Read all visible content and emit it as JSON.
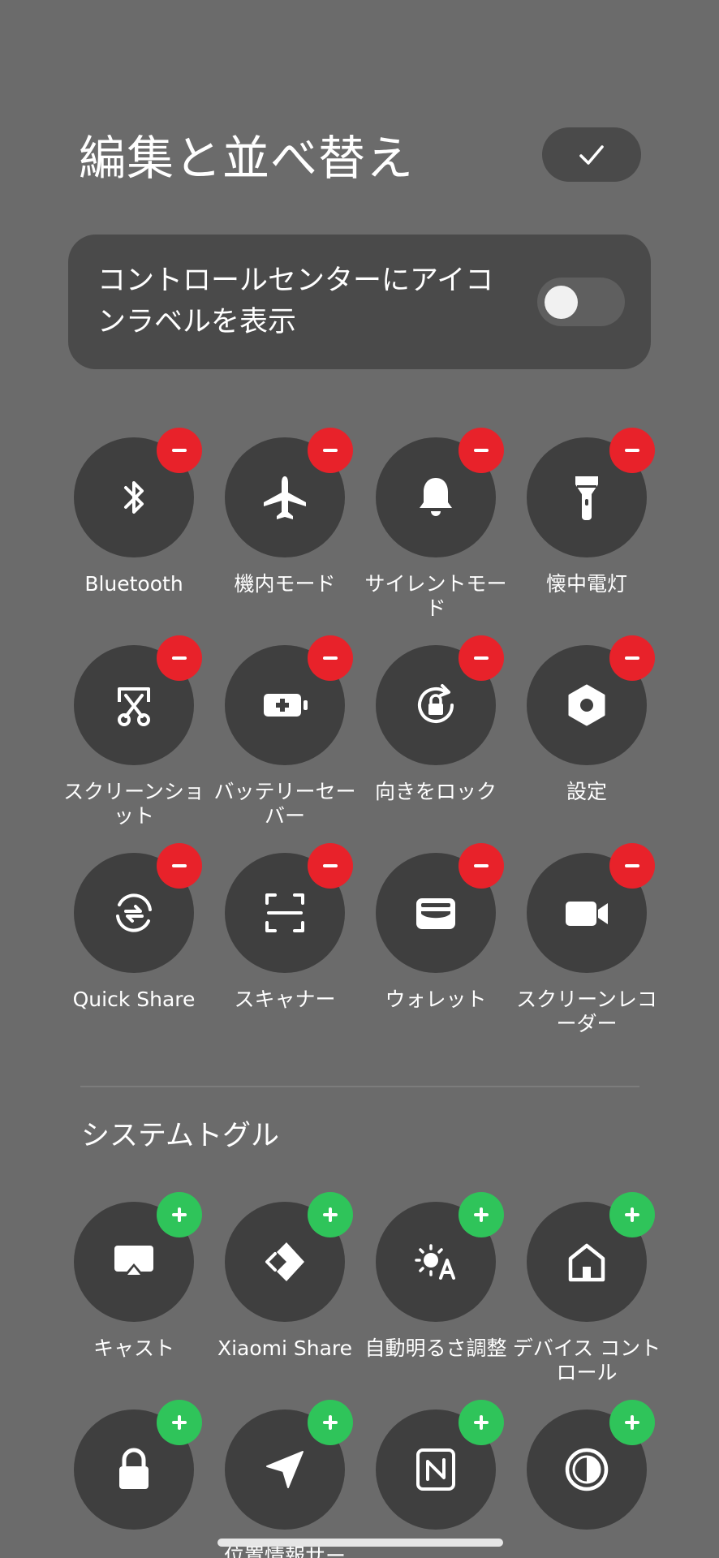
{
  "header": {
    "title": "編集と並べ替え",
    "done_icon": "checkmark-icon"
  },
  "label_setting": {
    "text": "コントロールセンターにアイコンラベルを表示",
    "toggle_on": false
  },
  "active_tiles": [
    {
      "label": "Bluetooth",
      "icon": "bluetooth-icon"
    },
    {
      "label": "機内モード",
      "icon": "airplane-icon"
    },
    {
      "label": "サイレントモード",
      "icon": "bell-icon"
    },
    {
      "label": "懐中電灯",
      "icon": "flashlight-icon"
    },
    {
      "label": "スクリーンショット",
      "icon": "screenshot-scissors-icon"
    },
    {
      "label": "バッテリーセーバー",
      "icon": "battery-plus-icon"
    },
    {
      "label": "向きをロック",
      "icon": "rotation-lock-icon"
    },
    {
      "label": "設定",
      "icon": "settings-hex-icon"
    },
    {
      "label": "Quick Share",
      "icon": "quick-share-icon"
    },
    {
      "label": "スキャナー",
      "icon": "scanner-icon"
    },
    {
      "label": "ウォレット",
      "icon": "wallet-icon"
    },
    {
      "label": "スクリーンレコーダー",
      "icon": "video-camera-icon"
    }
  ],
  "system_section": {
    "title": "システムトグル",
    "tiles": [
      {
        "label": "キャスト",
        "icon": "cast-icon"
      },
      {
        "label": "Xiaomi Share",
        "icon": "xiaomi-share-icon"
      },
      {
        "label": "自動明るさ調整",
        "icon": "auto-brightness-icon"
      },
      {
        "label": "デバイス コントロール",
        "icon": "home-icon"
      },
      {
        "label": "",
        "icon": "lock-icon"
      },
      {
        "label": "位置情報サー",
        "icon": "location-arrow-icon"
      },
      {
        "label": "",
        "icon": "nfc-icon"
      },
      {
        "label": "",
        "icon": "dark-mode-icon"
      }
    ]
  },
  "colors": {
    "background": "#6b6b6b",
    "tile": "#3f3f3f",
    "remove_badge": "#e8222a",
    "add_badge": "#2fc45a"
  }
}
